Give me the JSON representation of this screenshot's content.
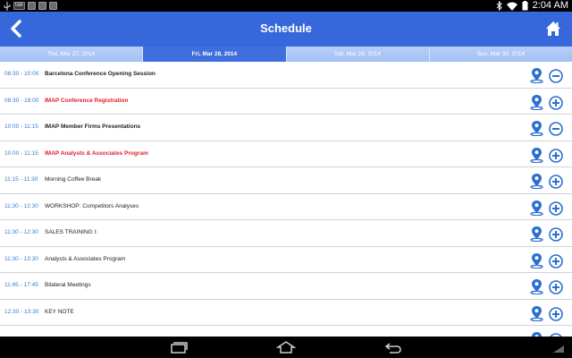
{
  "status_bar": {
    "time": "2:04 AM",
    "talk_label": "talk"
  },
  "header": {
    "title": "Schedule"
  },
  "date_tabs": [
    {
      "label": "Thu, Mar 27, 2014",
      "active": false
    },
    {
      "label": "Fri, Mar 28, 2014",
      "active": true
    },
    {
      "label": "Sat, Mar 29, 2014",
      "active": false
    },
    {
      "label": "Sun, Mar 30, 2014",
      "active": false
    }
  ],
  "colors": {
    "header": "#3668dc",
    "accent": "#3f6fdc",
    "time_text": "#2f7fd3",
    "highlight_text": "#e0202a"
  },
  "sessions": [
    {
      "time": "08:30 - 10:00",
      "name": "Barcelona Conference Opening Session",
      "style": "bold",
      "action": "minus-circle-icon"
    },
    {
      "time": "08:30 - 18:00",
      "name": "IMAP Conference Registration",
      "style": "red",
      "action": "plus-circle-icon"
    },
    {
      "time": "10:00 - 11:15",
      "name": "IMAP Member Firms Presentations",
      "style": "bold",
      "action": "minus-circle-icon"
    },
    {
      "time": "10:00 - 11:15",
      "name": "IMAP Analysts & Associates Program",
      "style": "red",
      "action": "plus-circle-icon"
    },
    {
      "time": "11:15 - 11:30",
      "name": "Morning Coffee Break",
      "style": "normal",
      "action": "plus-circle-icon"
    },
    {
      "time": "11:30 - 12:30",
      "name": "WORKSHOP: Competitors Analyses",
      "style": "normal",
      "action": "plus-circle-icon"
    },
    {
      "time": "11:30 - 12:30",
      "name": "SALES TRAINING I:",
      "style": "normal",
      "action": "plus-circle-icon"
    },
    {
      "time": "11:30 - 13:30",
      "name": "Analysts & Associates Program",
      "style": "normal",
      "action": "plus-circle-icon"
    },
    {
      "time": "11:45 - 17:45",
      "name": "Bilateral Meetings",
      "style": "normal",
      "action": "plus-circle-icon"
    },
    {
      "time": "12:30 - 13:30",
      "name": "KEY NOTE",
      "style": "normal",
      "action": "plus-circle-icon"
    },
    {
      "time": "",
      "name": "",
      "style": "normal",
      "action": "plus-circle-icon"
    }
  ],
  "icons": {
    "back": "chevron-left-icon",
    "home": "home-icon",
    "pin": "map-pin-icon"
  }
}
